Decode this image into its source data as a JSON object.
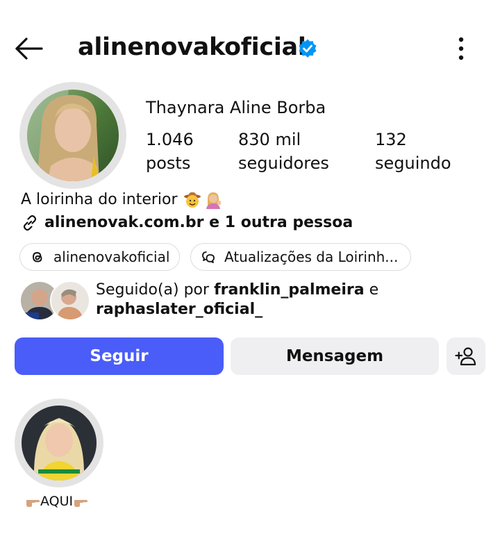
{
  "header": {
    "username": "alinenovakoficial",
    "verified": true,
    "back_icon": "arrow-left-icon",
    "more_icon": "more-vertical-icon"
  },
  "profile": {
    "display_name": "Thaynara Aline Borba",
    "stats": [
      {
        "value": "1.046",
        "label": "posts"
      },
      {
        "value": "830 mil",
        "label": "seguidores"
      },
      {
        "value": "132",
        "label": "seguindo"
      }
    ],
    "bio": "A loirinha do interior",
    "bio_emojis": [
      "cowboy-face-emoji",
      "woman-tipping-hand-emoji"
    ],
    "link_text": "alinenovak.com.br e 1 outra pessoa"
  },
  "chips": [
    {
      "icon": "threads-icon",
      "label": "alinenovakoficial"
    },
    {
      "icon": "channel-icon",
      "label": "Atualizações da Loirinh..."
    }
  ],
  "followed_by": {
    "prefix": "Seguido(a) por ",
    "user1": "franklin_palmeira",
    "joiner": " e",
    "user2": "raphaslater_oficial_"
  },
  "actions": {
    "follow_label": "Seguir",
    "message_label": "Mensagem",
    "add_user_icon": "person-add-icon"
  },
  "highlight": {
    "label": "AQUI"
  },
  "colors": {
    "accent": "#4a5df9",
    "verified_blue": "#0095f6",
    "button_secondary": "#efeff1"
  }
}
